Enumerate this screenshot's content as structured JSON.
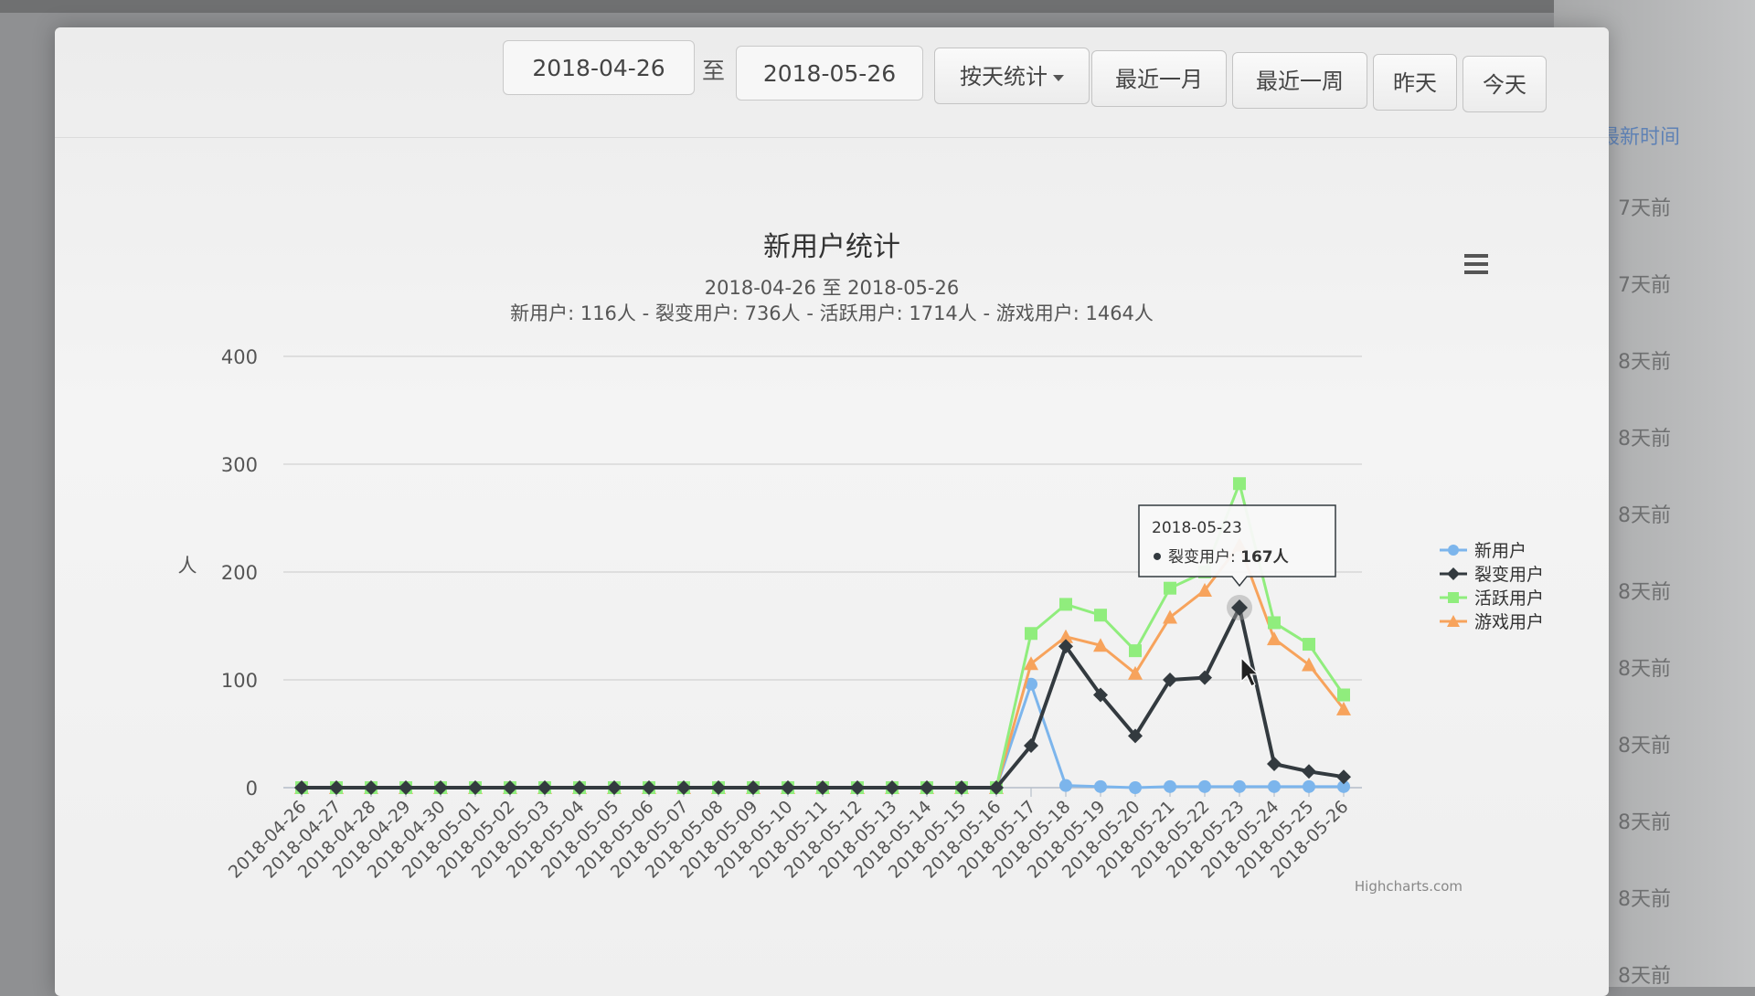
{
  "toolbar": {
    "start_date": "2018-04-26",
    "separator": "至",
    "end_date": "2018-05-26",
    "group_by": "按天统计",
    "last_month": "最近一月",
    "last_week": "最近一周",
    "yesterday": "昨天",
    "today": "今天"
  },
  "background_list": {
    "link": "最新时间",
    "items": [
      "7天前",
      "7天前",
      "8天前",
      "8天前",
      "8天前",
      "8天前",
      "8天前",
      "8天前",
      "8天前",
      "8天前",
      "8天前"
    ]
  },
  "chart_data": {
    "type": "line",
    "title": "新用户统计",
    "subtitle": "2018-04-26 至 2018-05-26",
    "summary": "新用户: 116人 - 裂变用户: 736人 - 活跃用户: 1714人 - 游戏用户: 1464人",
    "ylabel": "人",
    "ylim": [
      0,
      400
    ],
    "yticks": [
      0,
      100,
      200,
      300,
      400
    ],
    "grid": true,
    "legend_position": "right",
    "credit": "Highcharts.com",
    "categories": [
      "2018-04-26",
      "2018-04-27",
      "2018-04-28",
      "2018-04-29",
      "2018-04-30",
      "2018-05-01",
      "2018-05-02",
      "2018-05-03",
      "2018-05-04",
      "2018-05-05",
      "2018-05-06",
      "2018-05-07",
      "2018-05-08",
      "2018-05-09",
      "2018-05-10",
      "2018-05-11",
      "2018-05-12",
      "2018-05-13",
      "2018-05-14",
      "2018-05-15",
      "2018-05-16",
      "2018-05-17",
      "2018-05-18",
      "2018-05-19",
      "2018-05-20",
      "2018-05-21",
      "2018-05-22",
      "2018-05-23",
      "2018-05-24",
      "2018-05-25",
      "2018-05-26"
    ],
    "series": [
      {
        "name": "新用户",
        "color": "#7cb5ec",
        "marker": "circle",
        "values": [
          0,
          0,
          0,
          0,
          0,
          0,
          0,
          0,
          0,
          0,
          0,
          0,
          0,
          0,
          0,
          0,
          0,
          0,
          0,
          0,
          0,
          96,
          2,
          1,
          0,
          1,
          1,
          1,
          1,
          1,
          1
        ]
      },
      {
        "name": "裂变用户",
        "color": "#333a3f",
        "marker": "diamond",
        "values": [
          0,
          0,
          0,
          0,
          0,
          0,
          0,
          0,
          0,
          0,
          0,
          0,
          0,
          0,
          0,
          0,
          0,
          0,
          0,
          0,
          0,
          39,
          131,
          86,
          48,
          100,
          102,
          167,
          22,
          15,
          10
        ]
      },
      {
        "name": "活跃用户",
        "color": "#90ed7d",
        "marker": "square",
        "values": [
          0,
          0,
          0,
          0,
          0,
          0,
          0,
          0,
          0,
          0,
          0,
          0,
          0,
          0,
          0,
          0,
          0,
          0,
          0,
          0,
          0,
          143,
          170,
          160,
          127,
          185,
          200,
          282,
          153,
          133,
          86
        ]
      },
      {
        "name": "游戏用户",
        "color": "#f7a35c",
        "marker": "triangle",
        "values": [
          0,
          0,
          0,
          0,
          0,
          0,
          0,
          0,
          0,
          0,
          0,
          0,
          0,
          0,
          0,
          0,
          0,
          0,
          0,
          0,
          0,
          115,
          140,
          132,
          106,
          158,
          183,
          225,
          138,
          114,
          73
        ]
      }
    ],
    "tooltip": {
      "date": "2018-05-23",
      "series": "裂变用户",
      "value_text": "167人",
      "index": 27,
      "series_index": 1
    }
  }
}
